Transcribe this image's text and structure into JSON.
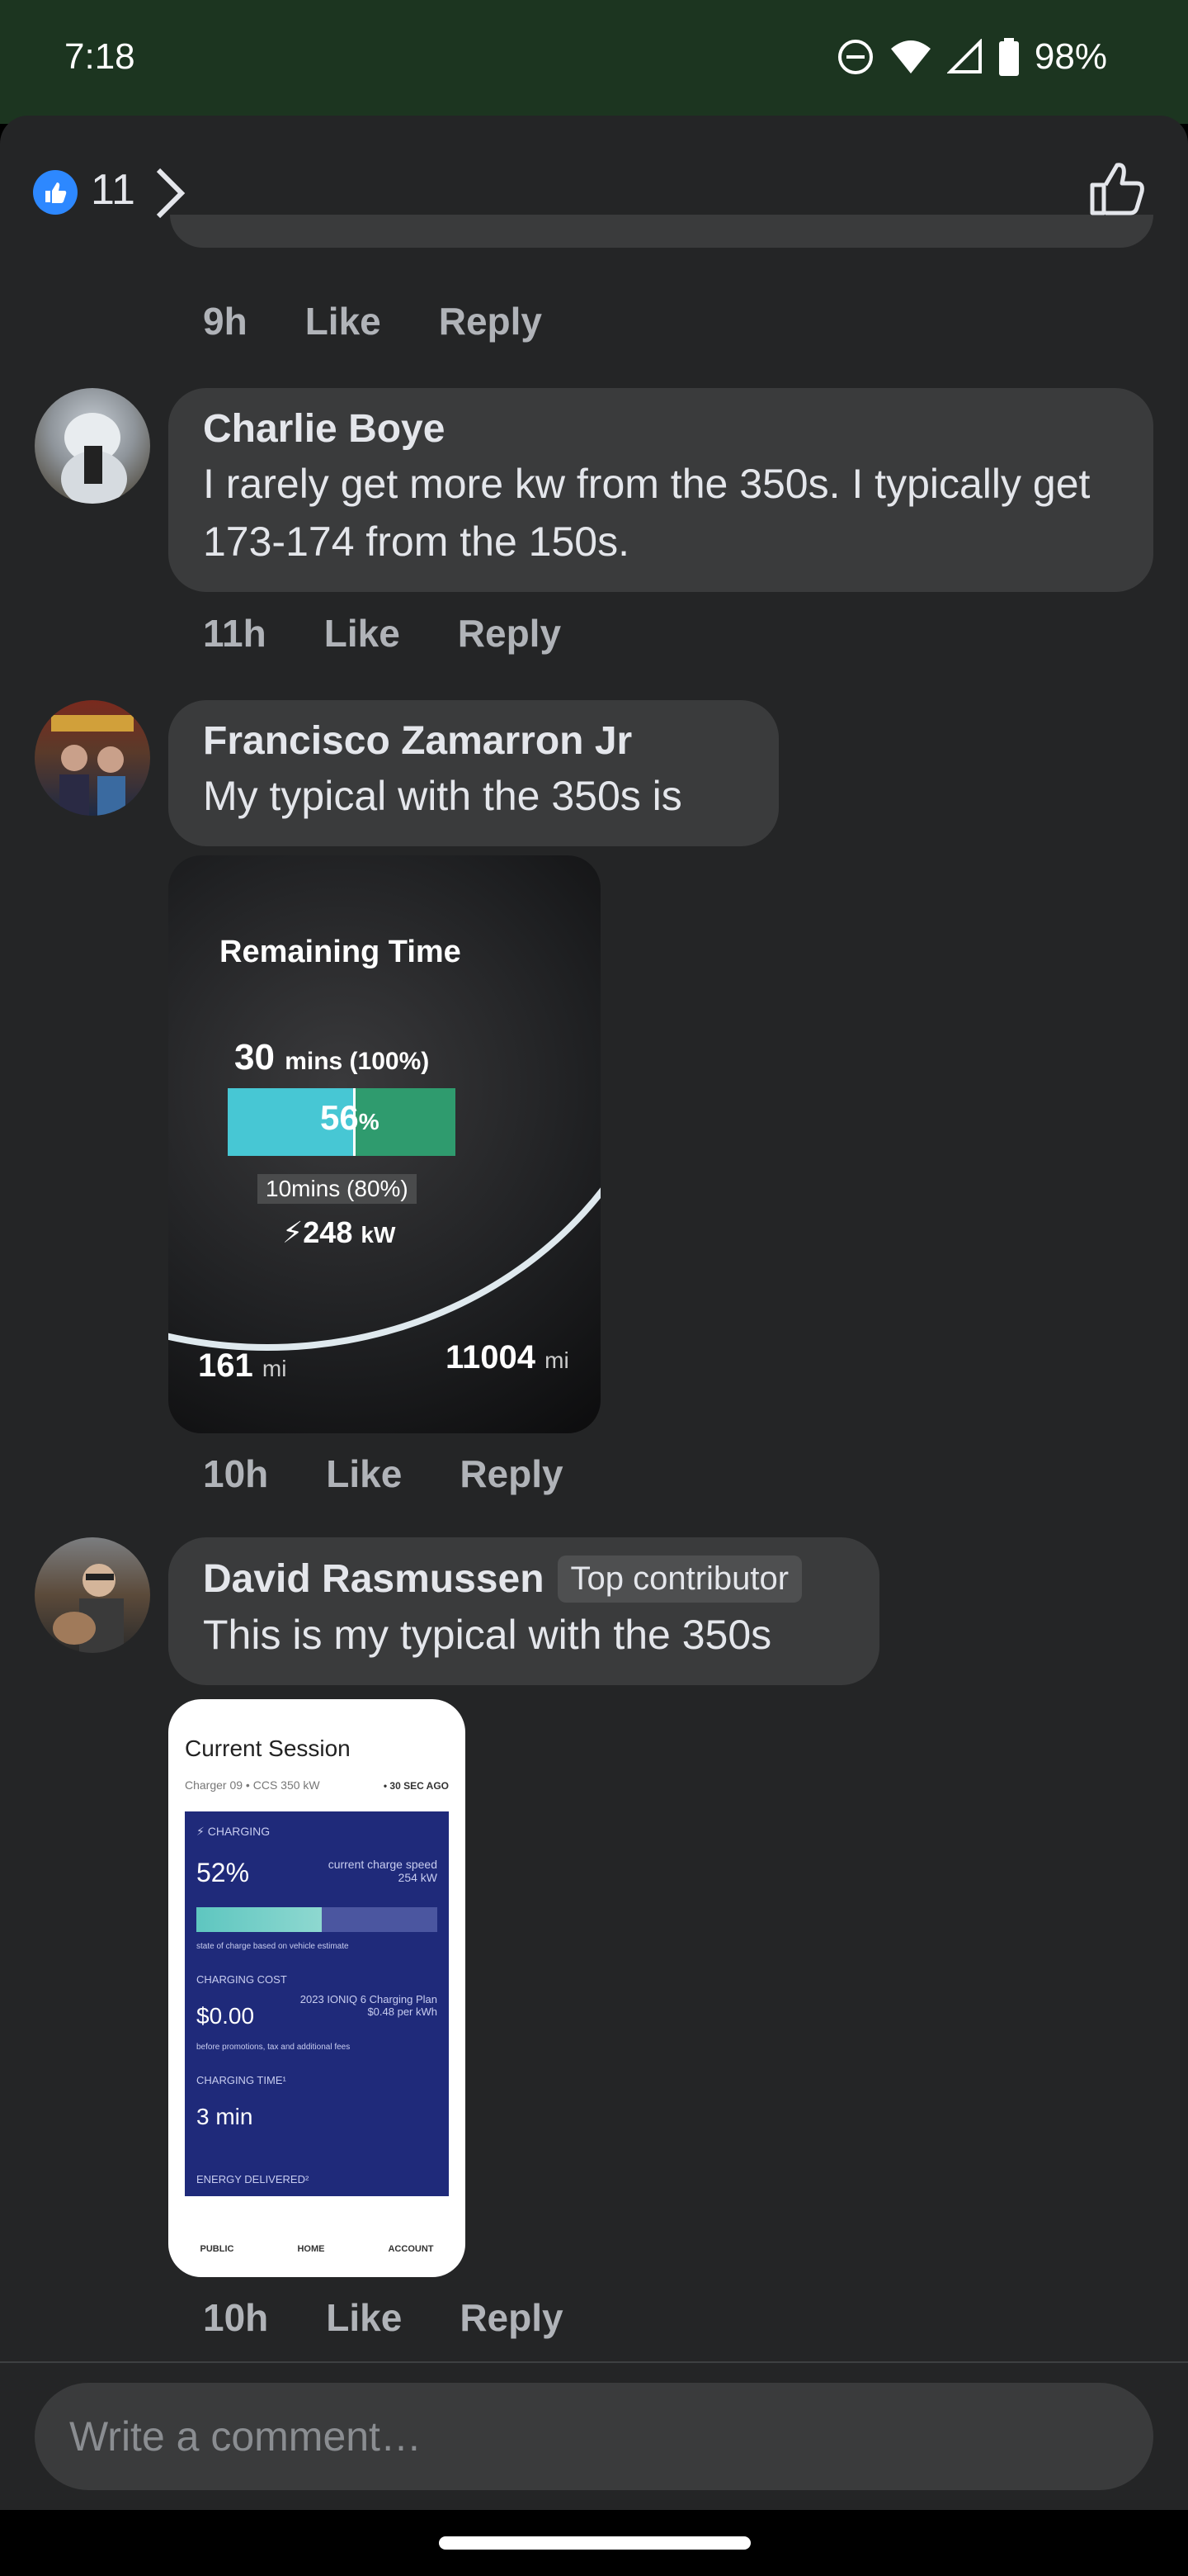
{
  "status_bar": {
    "time": "7:18",
    "battery": "98%"
  },
  "header": {
    "like_count": "11"
  },
  "comments": [
    {
      "author": "",
      "text": "",
      "time": "9h",
      "like_label": "Like",
      "reply_label": "Reply"
    },
    {
      "author": "Charlie Boye",
      "text": "I rarely get more kw from the 350s. I typically get 173-174 from the 150s.",
      "time": "11h",
      "like_label": "Like",
      "reply_label": "Reply"
    },
    {
      "author": "Francisco Zamarron Jr",
      "text": "My typical with the 350s is",
      "time": "10h",
      "like_label": "Like",
      "reply_label": "Reply",
      "photo": {
        "title": "Remaining Time",
        "full_time": "30",
        "full_unit": "mins (100%)",
        "soc": "56",
        "soc_unit": "%",
        "eighty_time": "10mins (80%)",
        "power": "248",
        "power_unit": "kW",
        "range": "161",
        "range_unit": "mi",
        "odometer": "11004",
        "odometer_unit": "mi"
      }
    },
    {
      "author": "David Rasmussen",
      "badge": "Top contributor",
      "text": "This is my typical with the 350s",
      "time": "10h",
      "like_label": "Like",
      "reply_label": "Reply",
      "photo": {
        "title": "Current Session",
        "charger": "Charger 09 • CCS 350 kW",
        "ago": "• 30 SEC AGO",
        "charging_label": "⚡ CHARGING",
        "soc": "52%",
        "speed_label": "current charge speed",
        "speed": "254 kW",
        "soc_note": "state of charge based on vehicle estimate",
        "cost_label": "CHARGING COST",
        "cost": "$0.00",
        "plan": "2023 IONIQ 6 Charging Plan",
        "rate": "$0.48 per kWh",
        "cost_note": "before promotions, tax and additional fees",
        "time_label": "CHARGING TIME¹",
        "time_value": "3 min",
        "energy_label": "ENERGY DELIVERED²",
        "nav_public": "PUBLIC",
        "nav_home": "HOME",
        "nav_account": "ACCOUNT"
      }
    }
  ],
  "composer": {
    "placeholder": "Write a comment…"
  }
}
